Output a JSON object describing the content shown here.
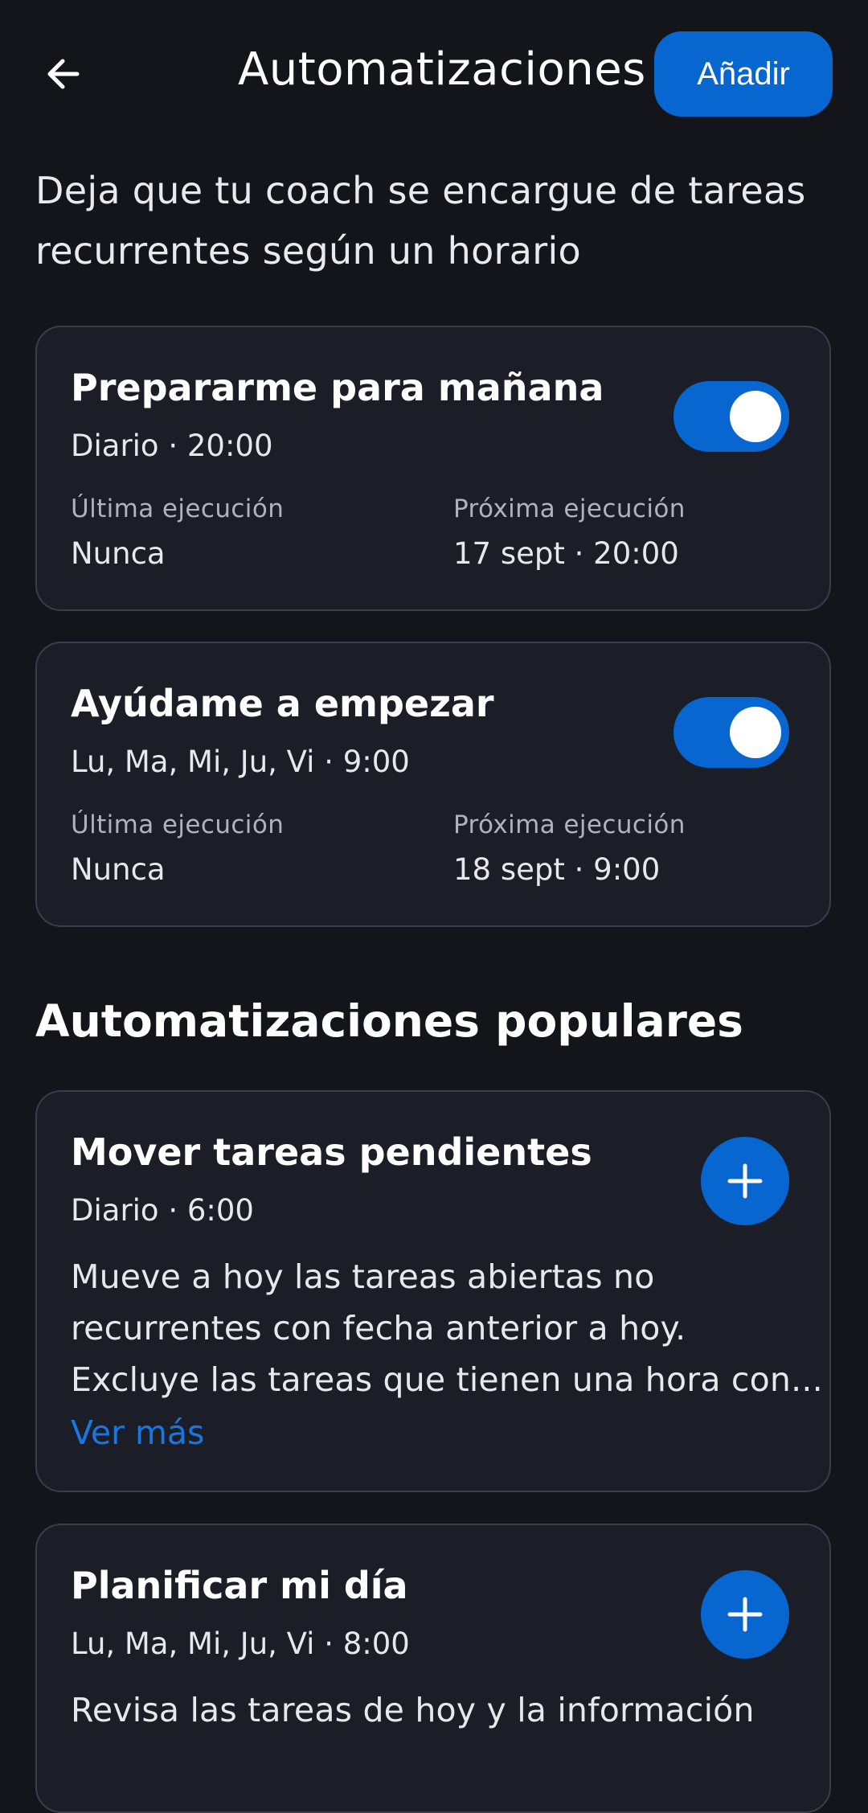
{
  "header": {
    "title": "Automatizaciones",
    "add_label": "Añadir",
    "back_icon": "arrow-left-icon"
  },
  "intro": {
    "line1": "Deja que tu coach se encargue de tareas",
    "line2": "recurrentes según un horario"
  },
  "automations": [
    {
      "title": "Prepararme para mañana",
      "schedule": "Diario · 20:00",
      "enabled": true,
      "last_label": "Última ejecución",
      "last_value": "Nunca",
      "next_label": "Próxima ejecución",
      "next_value": "17 sept · 20:00"
    },
    {
      "title": "Ayúdame a empezar",
      "schedule": "Lu, Ma, Mi, Ju, Vi · 9:00",
      "enabled": true,
      "last_label": "Última ejecución",
      "last_value": "Nunca",
      "next_label": "Próxima ejecución",
      "next_value": "18 sept · 9:00"
    }
  ],
  "popular": {
    "title": "Automatizaciones populares",
    "items": [
      {
        "title": "Mover tareas pendientes",
        "schedule": "Diario · 6:00",
        "desc_line1": "Mueve a hoy las tareas abiertas no",
        "desc_line2": "recurrentes con fecha anterior a hoy.",
        "desc_line3": "Excluye las tareas que tienen una hora con...",
        "see_more": "Ver más",
        "add_icon": "plus-icon"
      },
      {
        "title": "Planificar mi día",
        "schedule": "Lu, Ma, Mi, Ju, Vi · 8:00",
        "desc_line1": "Revisa las tareas de hoy y la información",
        "add_icon": "plus-icon"
      }
    ]
  },
  "colors": {
    "background": "#13151a",
    "card": "#1b1e26",
    "accent": "#0866d0",
    "link": "#1877e0"
  }
}
